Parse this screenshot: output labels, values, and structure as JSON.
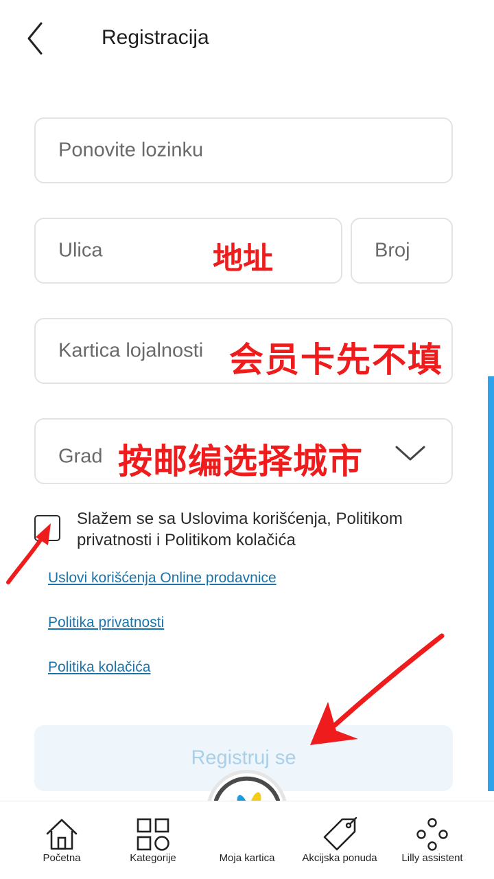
{
  "header": {
    "title": "Registracija"
  },
  "form": {
    "repeat_password": {
      "placeholder": "Ponovite lozinku"
    },
    "street": {
      "placeholder": "Ulica",
      "annotation": "地址"
    },
    "number": {
      "placeholder": "Broj"
    },
    "loyalty_card": {
      "placeholder": "Kartica lojalnosti",
      "annotation": "会员卡先不填"
    },
    "city": {
      "placeholder": "Grad",
      "annotation": "按邮编选择城市"
    },
    "consent": {
      "checked": false,
      "text": "Slažem se sa Uslovima korišćenja, Politikom privatnosti i Politikom kolačića"
    },
    "links": [
      {
        "label": "Uslovi korišćenja Online prodavnice"
      },
      {
        "label": "Politika privatnosti"
      },
      {
        "label": "Politika kolačića"
      }
    ],
    "submit_label": "Registruj se"
  },
  "bottom_nav": {
    "items": [
      {
        "label": "Početna",
        "icon": "home-icon"
      },
      {
        "label": "Kategorije",
        "icon": "categories-icon"
      },
      {
        "label": "Moja kartica",
        "icon": "loyalty-card-logo-icon"
      },
      {
        "label": "Akcijska ponuda",
        "icon": "price-tag-icon"
      },
      {
        "label": "Lilly assistent",
        "icon": "assistant-dots-icon"
      }
    ]
  },
  "colors": {
    "accent": "#2ea3ec",
    "link": "#1a73a9",
    "annotation_red": "#ee1c1c",
    "button_disabled_bg": "#eef6fc",
    "button_disabled_text": "#a9cfe9",
    "logo_blue": "#1f9ae0",
    "logo_yellow": "#f4cc1a"
  }
}
